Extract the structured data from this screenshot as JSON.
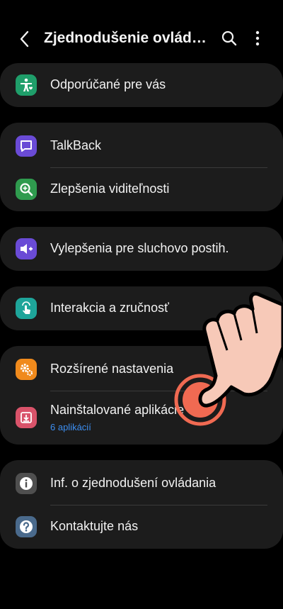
{
  "header": {
    "title": "Zjednodušenie ovládania",
    "back_icon": "back-arrow-icon",
    "search_icon": "search-icon",
    "more_icon": "more-vertical-icon"
  },
  "sections": [
    {
      "items": [
        {
          "label": "Odporúčané pre vás",
          "icon": "accessibility-heart-icon",
          "icon_color": "#1f9e6a"
        }
      ]
    },
    {
      "items": [
        {
          "label": "TalkBack",
          "icon": "talkback-icon",
          "icon_color": "#6a4bd6"
        },
        {
          "label": "Zlepšenia viditeľnosti",
          "icon": "visibility-zoom-icon",
          "icon_color": "#2f9b4e"
        }
      ]
    },
    {
      "items": [
        {
          "label": "Vylepšenia pre sluchovo postih.",
          "icon": "hearing-icon",
          "icon_color": "#6a4bd6"
        }
      ]
    },
    {
      "items": [
        {
          "label": "Interakcia a zručnosť",
          "icon": "interaction-hand-icon",
          "icon_color": "#1ea59a"
        }
      ]
    },
    {
      "items": [
        {
          "label": "Rozšírené nastavenia",
          "icon": "advanced-settings-icon",
          "icon_color": "#f08a1c"
        },
        {
          "label": "Nainštalované aplikácie",
          "sublabel": "6 aplikácií",
          "icon": "installed-apps-icon",
          "icon_color": "#d9536a"
        }
      ]
    },
    {
      "items": [
        {
          "label": "Inf. o zjednodušení ovládania",
          "icon": "info-icon",
          "icon_color": "#4f4f4f"
        },
        {
          "label": "Kontaktujte nás",
          "icon": "help-icon",
          "icon_color": "#4a6a8c"
        }
      ]
    }
  ],
  "colors": {
    "background": "#000000",
    "card": "#1c1c1c",
    "sublabel": "#3d8ef0",
    "tap_indicator": "#f06a52",
    "hand": "#f7c9b8"
  },
  "overlay": {
    "icon": "tap-gesture-hand-icon"
  }
}
